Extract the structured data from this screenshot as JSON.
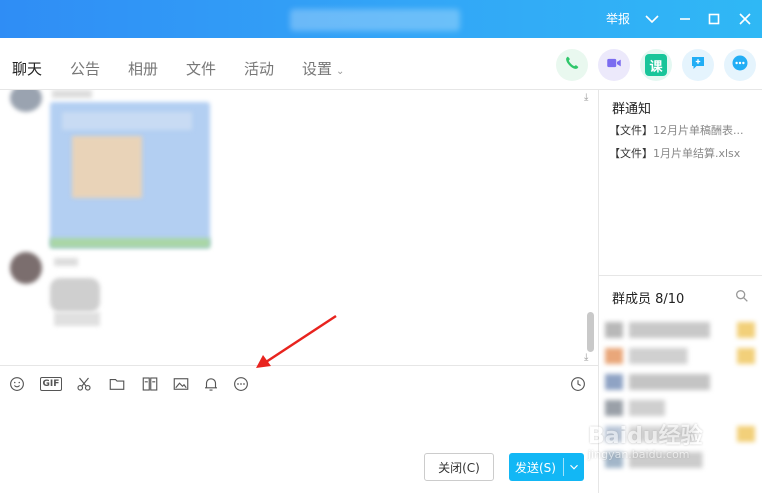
{
  "titlebar": {
    "report_label": "举报",
    "icons": [
      "chevron-down-icon",
      "minimize-icon",
      "maximize-icon",
      "close-icon"
    ]
  },
  "tabs": {
    "chat": "聊天",
    "announcement": "公告",
    "album": "相册",
    "files": "文件",
    "activity": "活动",
    "settings": "设置"
  },
  "actions": {
    "course_glyph": "课",
    "colors": {
      "phone": "#2fc76b",
      "video": "#7b6cf0",
      "course": "#19c59a",
      "message": "#22aef5",
      "more": "#22aef5"
    }
  },
  "toolbar": {
    "gif_label": "GIF",
    "icons": [
      "emoji-icon",
      "gif-icon",
      "scissors-icon",
      "folder-icon",
      "image-gallery-icon",
      "picture-icon",
      "bell-icon",
      "more-dots-icon",
      "history-clock-icon"
    ]
  },
  "input": {
    "close_label": "关闭(C)",
    "send_label": "发送(S)"
  },
  "right_panel": {
    "notice_title": "群通知",
    "files": [
      {
        "prefix": "【文件】",
        "name": "12月片单稿酬表..."
      },
      {
        "prefix": "【文件】",
        "name": "1月片单结算.xlsx"
      }
    ],
    "members_title": "群成员 8/10"
  },
  "watermark": {
    "text": "Baidu经验",
    "sub": "jingyan.baidu.com"
  },
  "accent_color": "#12b7f5",
  "annotation_color": "#e8231e"
}
